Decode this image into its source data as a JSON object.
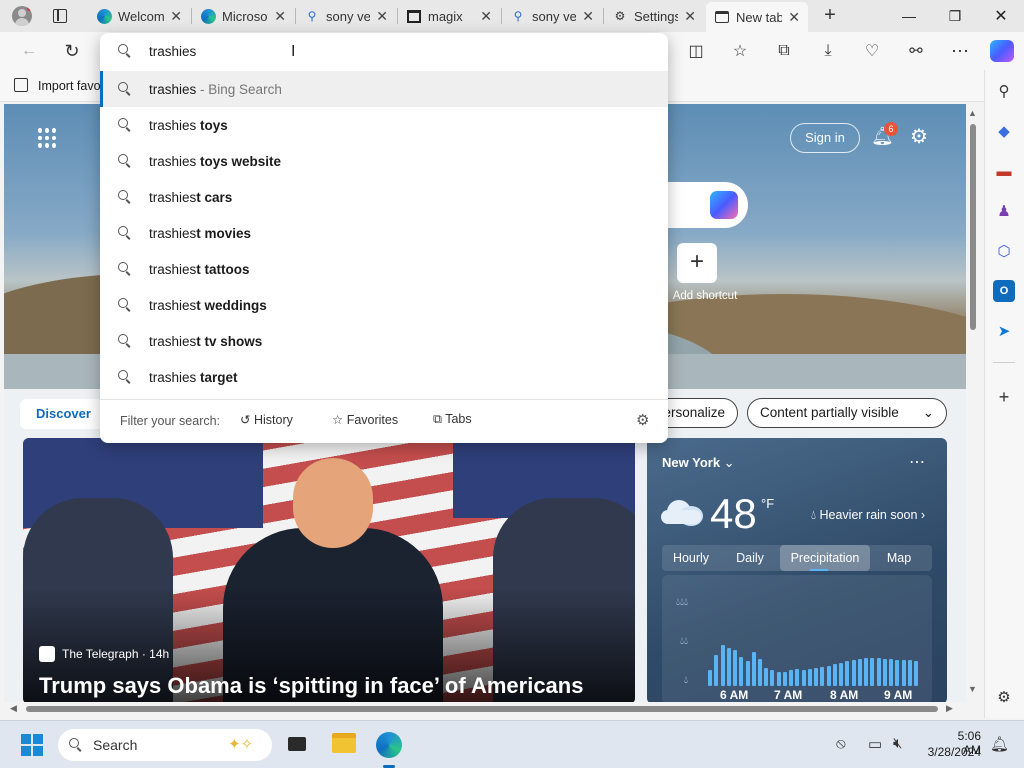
{
  "tabs": [
    {
      "title": "Welcome",
      "icon": "edge-icon"
    },
    {
      "title": "Microsoft",
      "icon": "edge-icon"
    },
    {
      "title": "sony ve",
      "icon": "search-icon"
    },
    {
      "title": "magix",
      "icon": "magix-icon"
    },
    {
      "title": "sony ve",
      "icon": "search-icon"
    },
    {
      "title": "Settings",
      "icon": "gear-icon"
    },
    {
      "title": "New tab",
      "icon": "newtab-icon"
    }
  ],
  "omnibox": {
    "query": "trashies",
    "suggestions": [
      {
        "base": "trashies",
        "bold": "",
        "suffix": " - Bing Search"
      },
      {
        "base": "trashies ",
        "bold": "toys",
        "suffix": ""
      },
      {
        "base": "trashies ",
        "bold": "toys website",
        "suffix": ""
      },
      {
        "base": "trashies",
        "bold": "t cars",
        "suffix": ""
      },
      {
        "base": "trashies",
        "bold": "t movies",
        "suffix": ""
      },
      {
        "base": "trashies",
        "bold": "t tattoos",
        "suffix": ""
      },
      {
        "base": "trashies",
        "bold": "t weddings",
        "suffix": ""
      },
      {
        "base": "trashies",
        "bold": "t tv shows",
        "suffix": ""
      },
      {
        "base": "trashies ",
        "bold": "target",
        "suffix": ""
      }
    ],
    "filter_label": "Filter your search:",
    "filters": [
      "History",
      "Favorites",
      "Tabs"
    ]
  },
  "favorites_bar": {
    "import_label": "Import favo"
  },
  "newtab": {
    "sign_in": "Sign in",
    "notif_count": "6",
    "add_shortcut": "Add shortcut",
    "discover": "Discover",
    "personalize": "ersonalize",
    "content_visibility": "Content partially visible"
  },
  "news": {
    "source": "The Telegraph",
    "age": "· 14h",
    "headline": "Trump says Obama is ‘spitting in face’ of Americans"
  },
  "weather": {
    "location": "New York",
    "temp": "48",
    "unit": "°F",
    "condition": "Heavier rain soon",
    "tabs": [
      "Hourly",
      "Daily",
      "Precipitation",
      "Map"
    ],
    "times": [
      "6 AM",
      "7 AM",
      "8 AM",
      "9 AM"
    ],
    "precip_levels": [
      0.35,
      0.7,
      0.9,
      0.85,
      0.8,
      0.65,
      0.55,
      0.75,
      0.6,
      0.4,
      0.35,
      0.3,
      0.32,
      0.35,
      0.38,
      0.36,
      0.38,
      0.4,
      0.42,
      0.45,
      0.48,
      0.52,
      0.55,
      0.58,
      0.6,
      0.62,
      0.62,
      0.62,
      0.6,
      0.6,
      0.58,
      0.58,
      0.57,
      0.56
    ],
    "accent": "#5ab3f2"
  },
  "taskbar": {
    "search": "Search",
    "time": "5:06 AM",
    "date": "3/28/2024"
  }
}
